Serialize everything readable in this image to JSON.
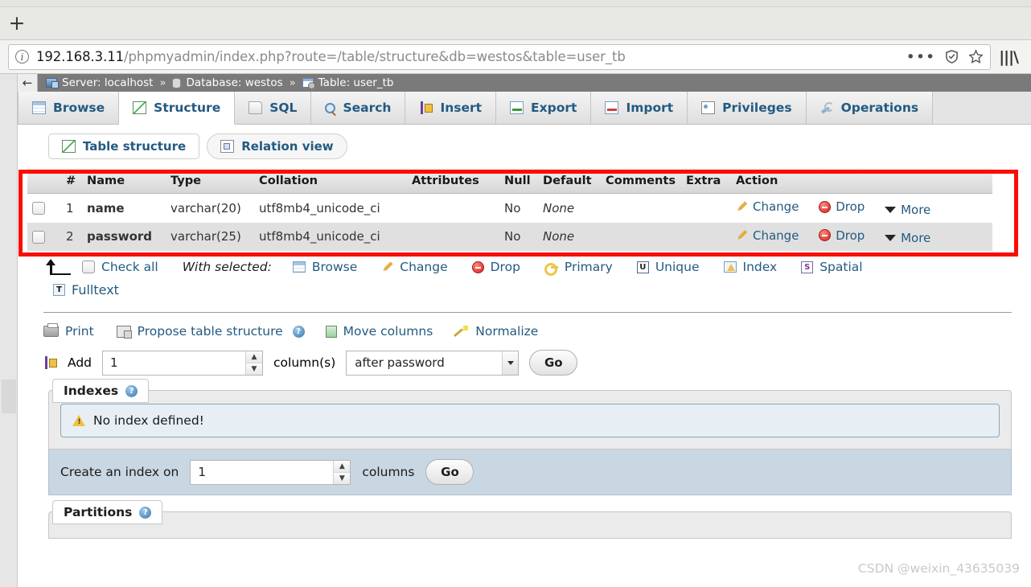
{
  "browser": {
    "new_tab_label": "+",
    "url_host": "192.168.3.11",
    "url_path": "/phpmyadmin/index.php?route=/table/structure&db=westos&table=user_tb",
    "menu_dots": "•••",
    "shield_icon": "shield-icon",
    "star_icon": "star-icon",
    "library_icon": "|||\\"
  },
  "breadcrumb": {
    "back_arrow": "←",
    "server": "Server: localhost",
    "database": "Database: westos",
    "table": "Table: user_tb",
    "separator": "»"
  },
  "main_tabs": [
    {
      "label": "Browse",
      "icon": "browse-icon",
      "active": false
    },
    {
      "label": "Structure",
      "icon": "structure-icon",
      "active": true
    },
    {
      "label": "SQL",
      "icon": "sql-icon",
      "active": false
    },
    {
      "label": "Search",
      "icon": "search-icon",
      "active": false
    },
    {
      "label": "Insert",
      "icon": "insert-icon",
      "active": false
    },
    {
      "label": "Export",
      "icon": "export-icon",
      "active": false
    },
    {
      "label": "Import",
      "icon": "import-icon",
      "active": false
    },
    {
      "label": "Privileges",
      "icon": "privileges-icon",
      "active": false
    },
    {
      "label": "Operations",
      "icon": "operations-icon",
      "active": false
    }
  ],
  "sub_tabs": [
    {
      "label": "Table structure",
      "icon": "structure-icon",
      "active": true
    },
    {
      "label": "Relation view",
      "icon": "relation-icon",
      "active": false
    }
  ],
  "structure_table": {
    "headers": [
      "",
      "#",
      "Name",
      "Type",
      "Collation",
      "Attributes",
      "Null",
      "Default",
      "Comments",
      "Extra",
      "Action"
    ],
    "rows": [
      {
        "num": "1",
        "name": "name",
        "type": "varchar(20)",
        "collation": "utf8mb4_unicode_ci",
        "attributes": "",
        "null": "No",
        "default": "None",
        "comments": "",
        "extra": "",
        "actions": [
          "Change",
          "Drop",
          "More"
        ]
      },
      {
        "num": "2",
        "name": "password",
        "type": "varchar(25)",
        "collation": "utf8mb4_unicode_ci",
        "attributes": "",
        "null": "No",
        "default": "None",
        "comments": "",
        "extra": "",
        "actions": [
          "Change",
          "Drop",
          "More"
        ]
      }
    ]
  },
  "with_selected": {
    "check_all": "Check all",
    "label": "With selected:",
    "actions": [
      {
        "label": "Browse",
        "icon": "browse-icon"
      },
      {
        "label": "Change",
        "icon": "pencil-icon"
      },
      {
        "label": "Drop",
        "icon": "drop-icon"
      },
      {
        "label": "Primary",
        "icon": "key-icon"
      },
      {
        "label": "Unique",
        "icon": "unique-icon"
      },
      {
        "label": "Index",
        "icon": "index-icon"
      },
      {
        "label": "Spatial",
        "icon": "spatial-icon"
      },
      {
        "label": "Fulltext",
        "icon": "fulltext-icon"
      }
    ]
  },
  "tools_row": [
    {
      "label": "Print",
      "icon": "print-icon",
      "help": false
    },
    {
      "label": "Propose table structure",
      "icon": "propose-icon",
      "help": true
    },
    {
      "label": "Move columns",
      "icon": "move-icon",
      "help": false
    },
    {
      "label": "Normalize",
      "icon": "normalize-icon",
      "help": false
    }
  ],
  "add_column": {
    "label": "Add",
    "count_value": "1",
    "unit": "column(s)",
    "position_value": "after password",
    "go_label": "Go"
  },
  "indexes_panel": {
    "legend": "Indexes",
    "help_icon": "?",
    "notice": "No index defined!",
    "create_label": "Create an index on",
    "create_value": "1",
    "columns_label": "columns",
    "go_label": "Go"
  },
  "partitions_panel": {
    "legend": "Partitions",
    "help_icon": "?"
  },
  "watermark": "CSDN @weixin_43635039",
  "colors": {
    "highlight_box": "#fb0d00",
    "link": "#235a81",
    "breadcrumb_bg": "#7a7a7a",
    "row_even": "#e0e0e0"
  }
}
